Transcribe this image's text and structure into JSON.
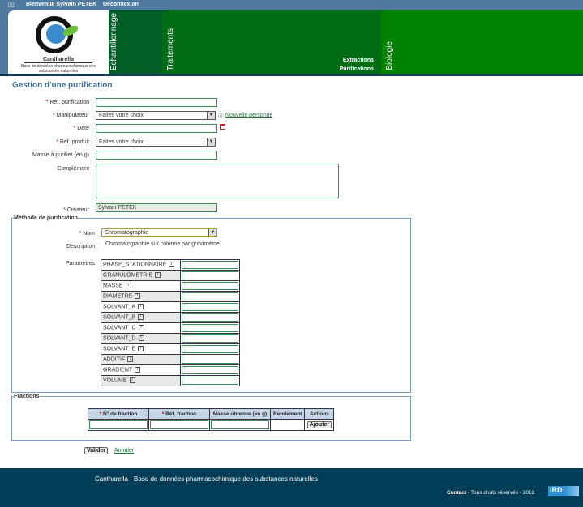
{
  "topbar": {
    "welcome": "Bienvenue",
    "user": "Sylvain PETEK",
    "logout": "Déconnexion"
  },
  "logo": {
    "name": "Cantharella",
    "subtitle": "Base de données pharmacochimique des substances naturelles"
  },
  "nav": {
    "tabs": [
      "Echantillonnage",
      "Traitements",
      "Biologie"
    ],
    "submenu": [
      "Extractions",
      "Purifications"
    ]
  },
  "page": {
    "title": "Gestion d'une purification"
  },
  "form": {
    "ref_purification": {
      "label": "Réf. purification",
      "value": ""
    },
    "manipulateur": {
      "label": "Manipulateur",
      "value": "Faites votre choix",
      "link": "Nouvelle personne"
    },
    "date": {
      "label": "Date",
      "value": ""
    },
    "ref_produit": {
      "label": "Réf. produit",
      "value": "Faites votre choix"
    },
    "masse": {
      "label": "Masse à purifier (en g)",
      "value": ""
    },
    "complement": {
      "label": "Complément",
      "value": ""
    },
    "createur": {
      "label": "Créateur",
      "value": "Sylvain PETEK"
    }
  },
  "methode": {
    "legend": "Méthode de purification",
    "nom_label": "Nom",
    "nom_value": "Chromatographie",
    "description_label": "Description",
    "description": "Chromatographie sur colonne par gravimétrie",
    "parametres_label": "Paramètres",
    "parametres": [
      "PHASE_STATIONNAIRE",
      "GRANULOMETRIE",
      "MASSE",
      "DIAMETRE",
      "SOLVANT_A",
      "SOLVANT_B",
      "SOLVANT_C",
      "SOLVANT_D",
      "SOLVANT_E",
      "ADDITIF",
      "GRADIENT",
      "VOLUME"
    ]
  },
  "fractions": {
    "legend": "Fractions",
    "columns": [
      "N° de fraction",
      "Réf. fraction",
      "Masse obtenue (en g)",
      "Rendement",
      "Actions"
    ],
    "add_button": "Ajouter"
  },
  "actions": {
    "submit": "Valider",
    "cancel": "Annuler"
  },
  "footer": {
    "title": "Cantharella - Base de données pharmacochimique des substances naturelles",
    "contact": "Contact",
    "rights": "- Tous droits réservés - 2012",
    "ird": "IRD"
  },
  "colors": {
    "topbar": "#50799f",
    "tab1": "#005f26",
    "tab2": "#006c16",
    "tab3": "#008000",
    "footer": "#003d56",
    "title": "#3a6d9b"
  }
}
